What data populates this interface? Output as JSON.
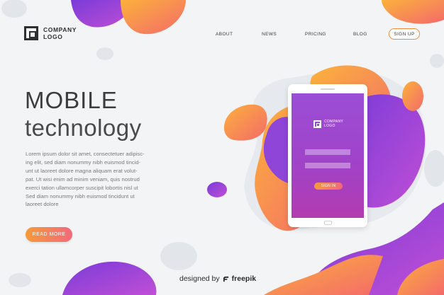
{
  "header": {
    "logo_line1": "COMPANY",
    "logo_line2": "LOGO",
    "nav": [
      "ABOUT",
      "NEWS",
      "PRICING",
      "BLOG"
    ],
    "signup_label": "SIGN UP"
  },
  "hero": {
    "title": "MOBILE",
    "subtitle": "technology",
    "body_lines": [
      "Lorem ipsum dolor sit amet, consectetuer adipisc-",
      "ing elit, sed diam nonummy nibh euismod tincid-",
      "unt ut laoreet dolore magna aliquam erat volut-",
      "pat. Ut wisi enim ad minim veniam, quis nostrud",
      "exerci tation ullamcorper suscipit lobortis nisl ut",
      "Sed diam nonummy nibh euismod tincidunt ut",
      "laoreet dolore"
    ],
    "read_more_label": "READ MORE"
  },
  "phone": {
    "logo_line1": "COMPANY",
    "logo_line2": "LOGO",
    "signin_label": "SIGN IN"
  },
  "credit": {
    "prefix": "designed by",
    "brand": "freepik"
  },
  "colors": {
    "orange": "#f59a3a",
    "purple": "#9b4ed6",
    "pink": "#f26a7c",
    "background": "#f3f4f6"
  },
  "icons": [
    "logo-mark-icon",
    "freepik-icon"
  ]
}
